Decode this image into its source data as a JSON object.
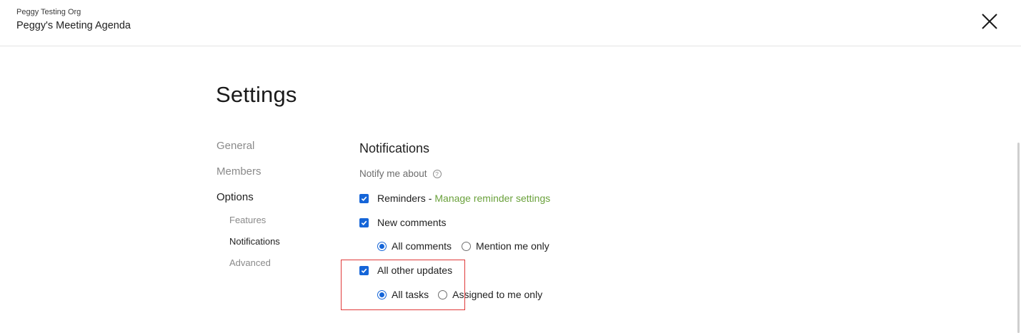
{
  "header": {
    "org_name": "Peggy Testing Org",
    "board_title": "Peggy's Meeting Agenda",
    "close_icon": "close-icon"
  },
  "page": {
    "title": "Settings"
  },
  "nav": {
    "items": [
      {
        "label": "General",
        "active": false
      },
      {
        "label": "Members",
        "active": false
      },
      {
        "label": "Options",
        "active": true
      }
    ],
    "sub_items": [
      {
        "label": "Features",
        "active": false
      },
      {
        "label": "Notifications",
        "active": true
      },
      {
        "label": "Advanced",
        "active": false
      }
    ]
  },
  "notifications": {
    "title": "Notifications",
    "notify_label": "Notify me about",
    "help_icon": "help-circle-icon",
    "reminders": {
      "label": "Reminders",
      "separator": "-",
      "link": "Manage reminder settings",
      "checked": true
    },
    "new_comments": {
      "label": "New comments",
      "checked": true,
      "options": [
        {
          "label": "All comments",
          "selected": true
        },
        {
          "label": "Mention me only",
          "selected": false
        }
      ]
    },
    "other_updates": {
      "label": "All other updates",
      "checked": true,
      "options": [
        {
          "label": "All tasks",
          "selected": true
        },
        {
          "label": "Assigned to me only",
          "selected": false
        }
      ]
    }
  },
  "colors": {
    "accent_blue": "#1565d8",
    "link_green": "#6aa13b",
    "highlight_red": "#e03a3a"
  }
}
